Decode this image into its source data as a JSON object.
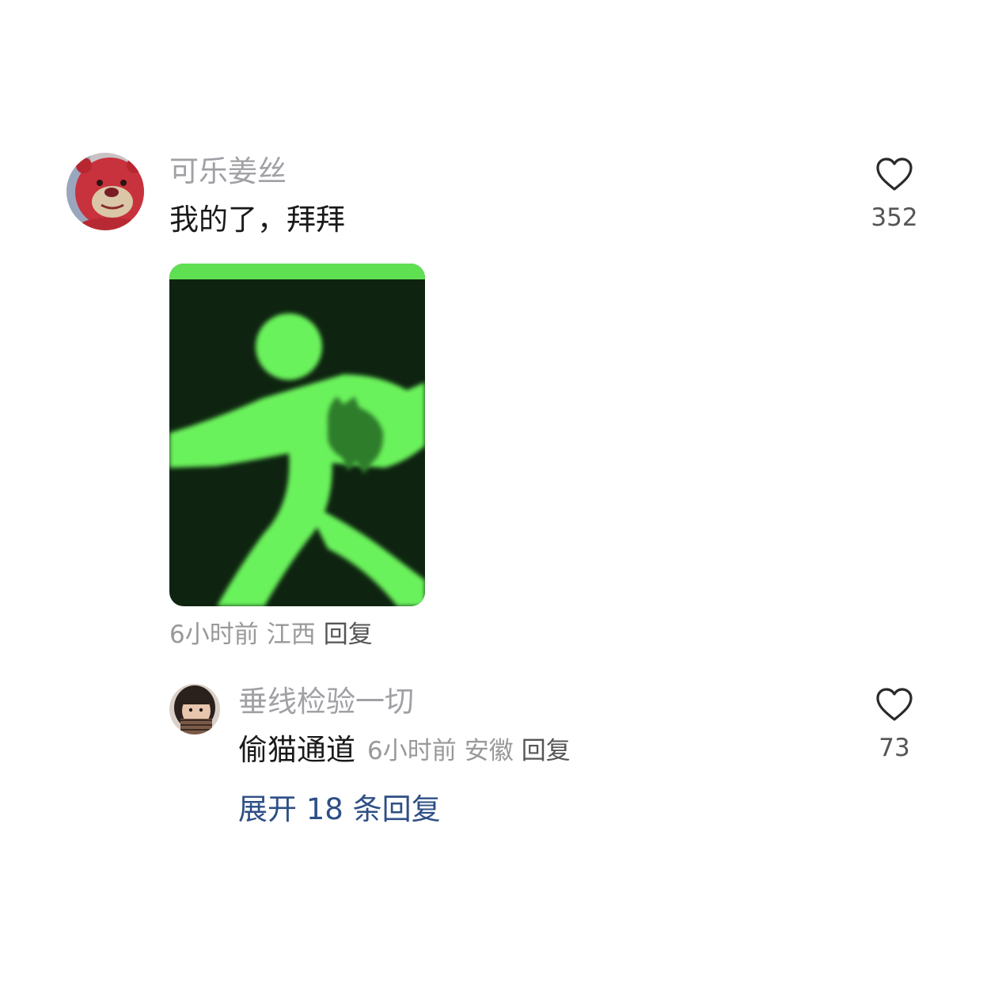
{
  "comment": {
    "username": "可乐姜丝",
    "text": "我的了，拜拜",
    "likes": "352",
    "time": "6小时前",
    "location": "江西",
    "reply_label": "回复",
    "avatar_icon": "strawberry-bear-avatar",
    "sticker_icon": "green-running-exit-sign-with-cat"
  },
  "reply": {
    "username": "垂线检验一切",
    "text": "偷猫通道",
    "likes": "73",
    "time": "6小时前",
    "location": "安徽",
    "reply_label": "回复",
    "avatar_icon": "girl-avatar"
  },
  "expand_label": "展开 18 条回复",
  "colors": {
    "username": "#a0a0a5",
    "text": "#1a1a1a",
    "meta": "#999999",
    "link": "#2e4f86",
    "sign_green": "#6af25c",
    "sign_dark": "#0e2410"
  }
}
